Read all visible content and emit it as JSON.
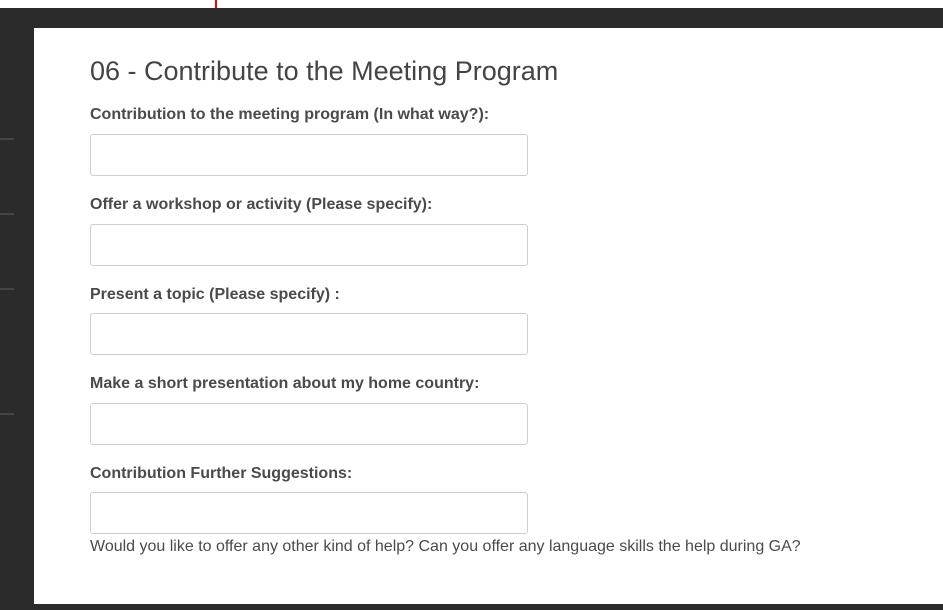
{
  "section": {
    "title": "06 - Contribute to the Meeting Program"
  },
  "fields": [
    {
      "label": "Contribution to the meeting program (In what way?):",
      "value": "",
      "placeholder": ""
    },
    {
      "label": "Offer a workshop or activity (Please specify):",
      "value": "",
      "placeholder": ""
    },
    {
      "label": "Present a topic (Please specify) :",
      "value": "",
      "placeholder": ""
    },
    {
      "label": "Make a short presentation about my home country:",
      "value": "",
      "placeholder": ""
    },
    {
      "label": "Contribution Further Suggestions:",
      "value": "",
      "placeholder": ""
    }
  ],
  "help_question": "Would you like to offer any other kind of help? Can you offer any language skills the help during GA?",
  "colors": {
    "backdrop": "#2b2b2b",
    "panel": "#ffffff",
    "text": "#4a4a4a",
    "input_border": "#cfcfcf",
    "accent_mark": "#ff0000"
  }
}
